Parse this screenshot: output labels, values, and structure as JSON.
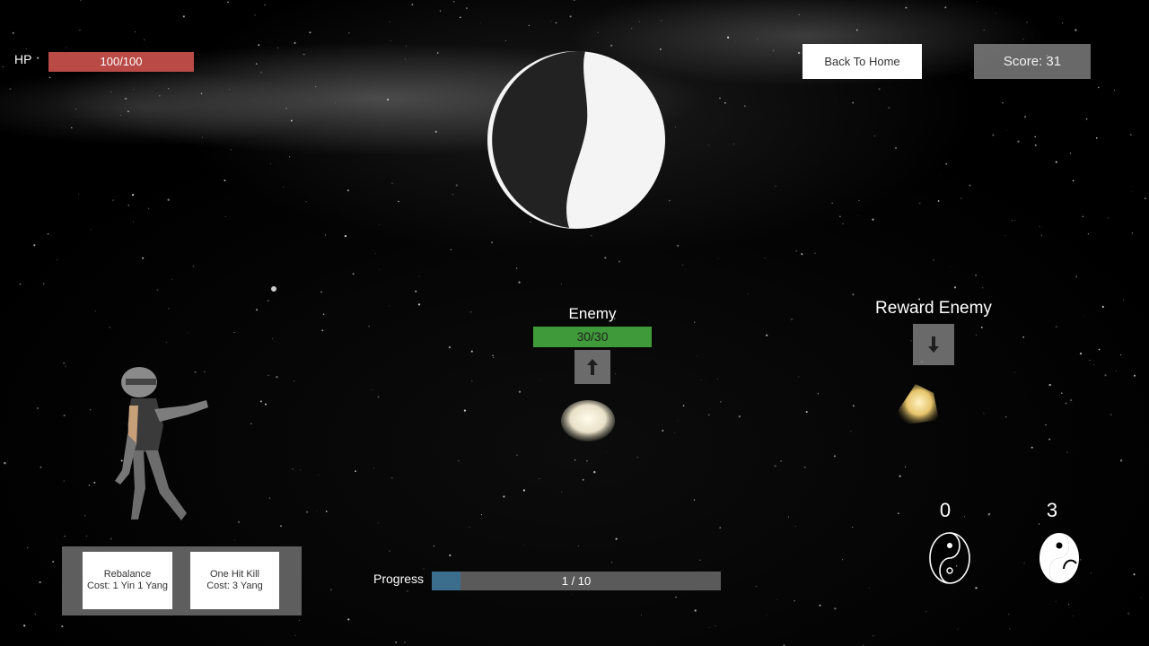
{
  "hud": {
    "hp_label": "HP",
    "hp_text": "100/100",
    "hp_fraction": 1.0,
    "back_button": "Back To Home",
    "score_text": "Score: 31"
  },
  "enemy": {
    "label": "Enemy",
    "hp_text": "30/30",
    "hp_fraction": 1.0,
    "arrow_icon": "arrow-up-icon"
  },
  "reward_enemy": {
    "label": "Reward Enemy",
    "arrow_icon": "arrow-down-icon"
  },
  "abilities": [
    {
      "name": "Rebalance",
      "cost": "Cost: 1 Yin 1 Yang"
    },
    {
      "name": "One Hit Kill",
      "cost": "Cost: 3 Yang"
    }
  ],
  "progress": {
    "label": "Progress",
    "text": "1 / 10",
    "fraction": 0.1
  },
  "resources": {
    "yin_count": "0",
    "yang_count": "3",
    "yin_icon": "yin-icon",
    "yang_icon": "yang-icon"
  },
  "colors": {
    "hp_bar": "#b94a46",
    "enemy_hp_bar": "#3f9a3a",
    "progress_fill": "#3b6e8c"
  }
}
